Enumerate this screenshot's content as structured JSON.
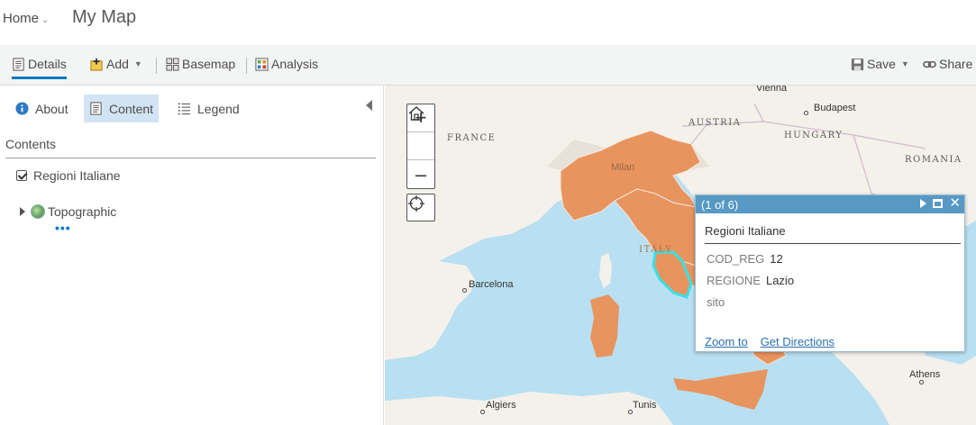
{
  "header": {
    "home_label": "Home",
    "map_title": "My Map"
  },
  "toolbar": {
    "details": "Details",
    "add": "Add",
    "basemap": "Basemap",
    "analysis": "Analysis",
    "save": "Save",
    "share": "Share"
  },
  "panel": {
    "tabs": [
      {
        "label": "About",
        "icon": "info-icon"
      },
      {
        "label": "Content",
        "icon": "content-icon"
      },
      {
        "label": "Legend",
        "icon": "legend-icon"
      }
    ],
    "contents_heading": "Contents",
    "layers": [
      {
        "label": "Regioni Italiane",
        "checked": true
      }
    ],
    "basemap_layer": "Topographic",
    "more": "•••"
  },
  "map": {
    "labels": {
      "vienna": "Vienna",
      "austria": "AUSTRIA",
      "budapest": "Budapest",
      "hungary": "HUNGARY",
      "france": "FRANCE",
      "romania": "ROMANIA",
      "milan": "Milan",
      "italy": "ITALY",
      "barcelona": "Barcelona",
      "athens": "Athens",
      "algiers": "Algiers",
      "tunis": "Tunis"
    },
    "colors": {
      "sea": "#b9e0f2",
      "land": "#f4f1ea",
      "region_fill": "#e8945e",
      "selected_outline": "#35e3e8"
    }
  },
  "popup": {
    "counter": "(1 of 6)",
    "title": "Regioni Italiane",
    "attrs": [
      {
        "key": "COD_REG",
        "value": "12"
      },
      {
        "key": "REGIONE",
        "value": "Lazio"
      },
      {
        "key": "sito",
        "value": ""
      }
    ],
    "zoom_to": "Zoom to",
    "get_directions": "Get Directions"
  }
}
